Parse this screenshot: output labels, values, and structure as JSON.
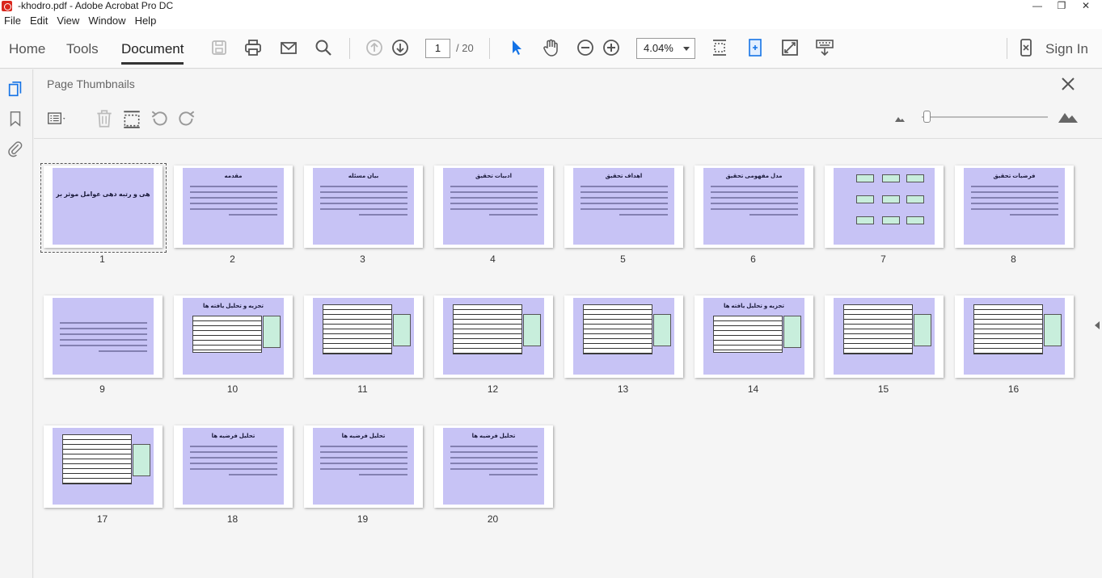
{
  "window": {
    "title": "-khodro.pdf - Adobe Acrobat Pro DC",
    "controls": [
      "—",
      "❐",
      "✕"
    ]
  },
  "menu": [
    "File",
    "Edit",
    "View",
    "Window",
    "Help"
  ],
  "toolbar": {
    "tabs": [
      "Home",
      "Tools",
      "Document"
    ],
    "active_tab": "Document",
    "current_page": "1",
    "total_pages": "/ 20",
    "zoom": "4.04%",
    "sign_in": "Sign In"
  },
  "panel": {
    "title": "Page Thumbnails"
  },
  "thumbnails": [
    {
      "number": "1",
      "title": "وزن دهی و رتبه دهی عوامل موثر بر",
      "selected": true
    },
    {
      "number": "2",
      "title": "مقدمه"
    },
    {
      "number": "3",
      "title": "بیان مسئله"
    },
    {
      "number": "4",
      "title": "ادبیات تحقیق"
    },
    {
      "number": "5",
      "title": "اهداف تحقیق"
    },
    {
      "number": "6",
      "title": "مدل مفهومی تحقیق"
    },
    {
      "number": "7",
      "title": ""
    },
    {
      "number": "8",
      "title": "فرضیات تحقیق"
    },
    {
      "number": "9",
      "title": ""
    },
    {
      "number": "10",
      "title": "تجزیه و تحلیل یافته ها"
    },
    {
      "number": "11",
      "title": ""
    },
    {
      "number": "12",
      "title": ""
    },
    {
      "number": "13",
      "title": ""
    },
    {
      "number": "14",
      "title": "تجزیه و تحلیل یافته ها"
    },
    {
      "number": "15",
      "title": ""
    },
    {
      "number": "16",
      "title": ""
    },
    {
      "number": "17",
      "title": ""
    },
    {
      "number": "18",
      "title": "تحلیل فرضیه ها"
    },
    {
      "number": "19",
      "title": "تحلیل فرضیه ها"
    },
    {
      "number": "20",
      "title": "تحلیل فرضیه ها"
    }
  ],
  "colors": {
    "slide_background": "#c7c3f5",
    "accent_blue": "#1473e6"
  }
}
